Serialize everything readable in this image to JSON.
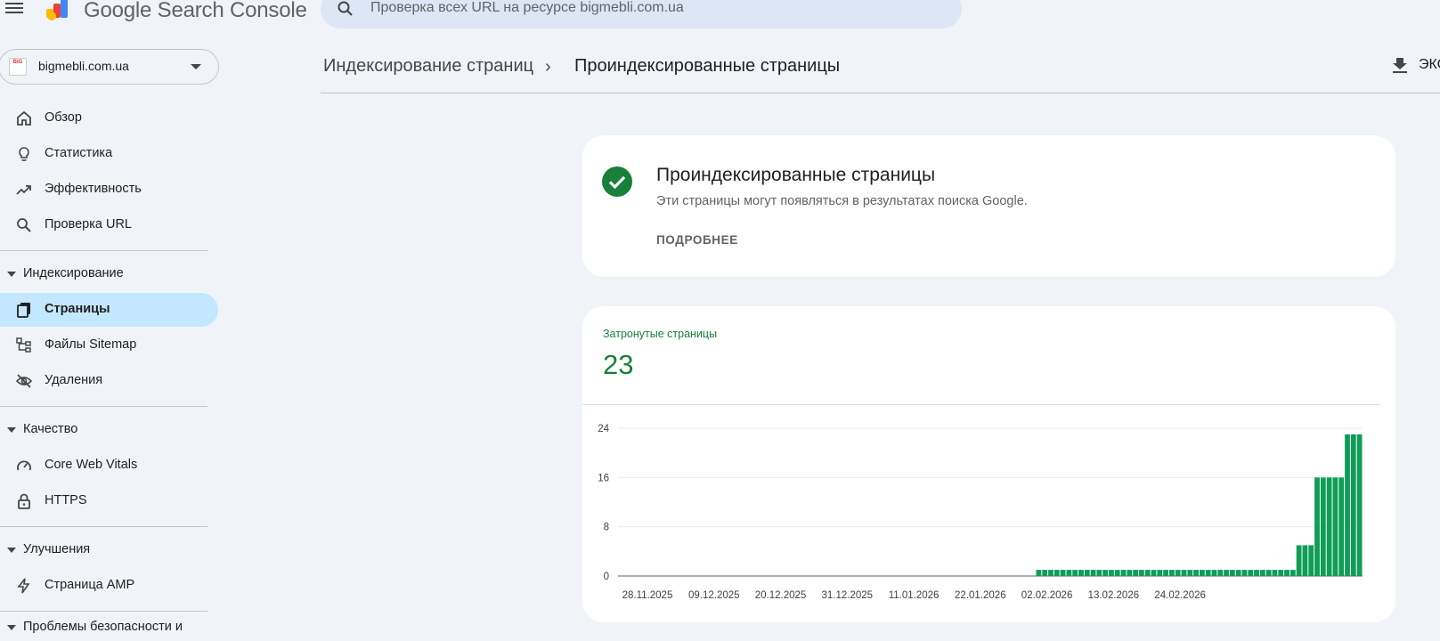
{
  "app": {
    "title": "Google Search Console"
  },
  "search": {
    "placeholder": "Проверка всех URL на ресурсе bigmebli.com.ua"
  },
  "property": {
    "name": "bigmebli.com.ua",
    "logo_text": "BIG"
  },
  "sidebar": {
    "items_top": [
      {
        "label": "Обзор",
        "icon": "home-icon"
      },
      {
        "label": "Статистика",
        "icon": "lightbulb-icon"
      },
      {
        "label": "Эффективность",
        "icon": "trending-up-icon"
      },
      {
        "label": "Проверка URL",
        "icon": "search-icon"
      }
    ],
    "sections": [
      {
        "label": "Индексирование",
        "items": [
          {
            "label": "Страницы",
            "icon": "pages-icon",
            "active": true
          },
          {
            "label": "Файлы Sitemap",
            "icon": "sitemap-icon"
          },
          {
            "label": "Удаления",
            "icon": "eye-off-icon"
          }
        ]
      },
      {
        "label": "Качество",
        "items": [
          {
            "label": "Core Web Vitals",
            "icon": "speed-icon"
          },
          {
            "label": "HTTPS",
            "icon": "lock-icon"
          }
        ]
      },
      {
        "label": "Улучшения",
        "items": [
          {
            "label": "Страница AMP",
            "icon": "bolt-icon"
          }
        ]
      },
      {
        "label": "Проблемы безопасности и"
      }
    ]
  },
  "breadcrumb": {
    "parent": "Индексирование страниц",
    "separator": "›",
    "current": "Проиндексированные страницы"
  },
  "export": {
    "label": "ЭКС",
    "icon": "download-icon"
  },
  "status_card": {
    "icon": "check-circle-icon",
    "title": "Проиндексированные страницы",
    "description": "Эти страницы могут появляться в результатах поиска Google.",
    "more_label": "ПОДРОБНЕЕ"
  },
  "metric": {
    "label": "Затронутые страницы",
    "value": "23"
  },
  "colors": {
    "accent_green": "#188038",
    "bar_green": "#0f9d58",
    "active_nav": "#c2e7ff"
  },
  "chart_data": {
    "type": "bar",
    "ylim": [
      0,
      24
    ],
    "yticks": [
      0,
      8,
      16,
      24
    ],
    "xtick_labels": [
      "28.11.2025",
      "09.12.2025",
      "20.12.2025",
      "31.12.2025",
      "11.01.2026",
      "22.01.2026",
      "02.02.2026",
      "13.02.2026",
      "24.02.2026"
    ],
    "series": [
      {
        "values": [
          0,
          0,
          0,
          0,
          0,
          0,
          0,
          0,
          0,
          0,
          0,
          0,
          0,
          0,
          0,
          0,
          0,
          0,
          0,
          0,
          0,
          0,
          0,
          0,
          0,
          0,
          0,
          0,
          0,
          0,
          0,
          0,
          0,
          0,
          0,
          0,
          0,
          0,
          0,
          0,
          0,
          0,
          0,
          0,
          0,
          0,
          0,
          0,
          0,
          0,
          0,
          0,
          0,
          0,
          0,
          0,
          0,
          0,
          0,
          0,
          0,
          0,
          0,
          0,
          0,
          0,
          0,
          0,
          0,
          1,
          1,
          1,
          1,
          1,
          1,
          1,
          1,
          1,
          1,
          1,
          1,
          1,
          1,
          1,
          1,
          1,
          1,
          1,
          1,
          1,
          1,
          1,
          1,
          1,
          1,
          1,
          1,
          1,
          1,
          1,
          1,
          1,
          1,
          1,
          1,
          1,
          1,
          1,
          1,
          1,
          1,
          1,
          5,
          5,
          5,
          16,
          16,
          16,
          16,
          16,
          23,
          23,
          23
        ]
      }
    ],
    "grid": true,
    "legend": "none"
  }
}
